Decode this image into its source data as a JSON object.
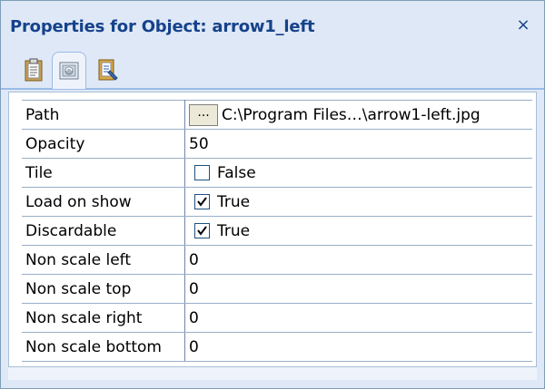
{
  "panel": {
    "title": "Properties for Object: arrow1_left",
    "close_glyph": "×"
  },
  "toolbar": {
    "buttons": [
      {
        "icon": "clipboard-icon"
      },
      {
        "icon": "image-properties-icon",
        "active": true
      },
      {
        "icon": "notes-icon"
      }
    ]
  },
  "properties": [
    {
      "label": "Path",
      "browse": "...",
      "value": "C:\\Program Files…\\arrow1-left.jpg"
    },
    {
      "label": "Opacity",
      "value": "50"
    },
    {
      "label": "Tile",
      "checked": false,
      "value": "False"
    },
    {
      "label": "Load on show",
      "checked": true,
      "value": "True"
    },
    {
      "label": "Discardable",
      "checked": true,
      "value": "True"
    },
    {
      "label": "Non scale left",
      "value": "0"
    },
    {
      "label": "Non scale top",
      "value": "0"
    },
    {
      "label": "Non scale right",
      "value": "0"
    },
    {
      "label": "Non scale bottom",
      "value": "0"
    }
  ],
  "colors": {
    "title": "#15428b",
    "panel_bg": "#dfe8f6",
    "grid_line": "#9aaec8"
  }
}
